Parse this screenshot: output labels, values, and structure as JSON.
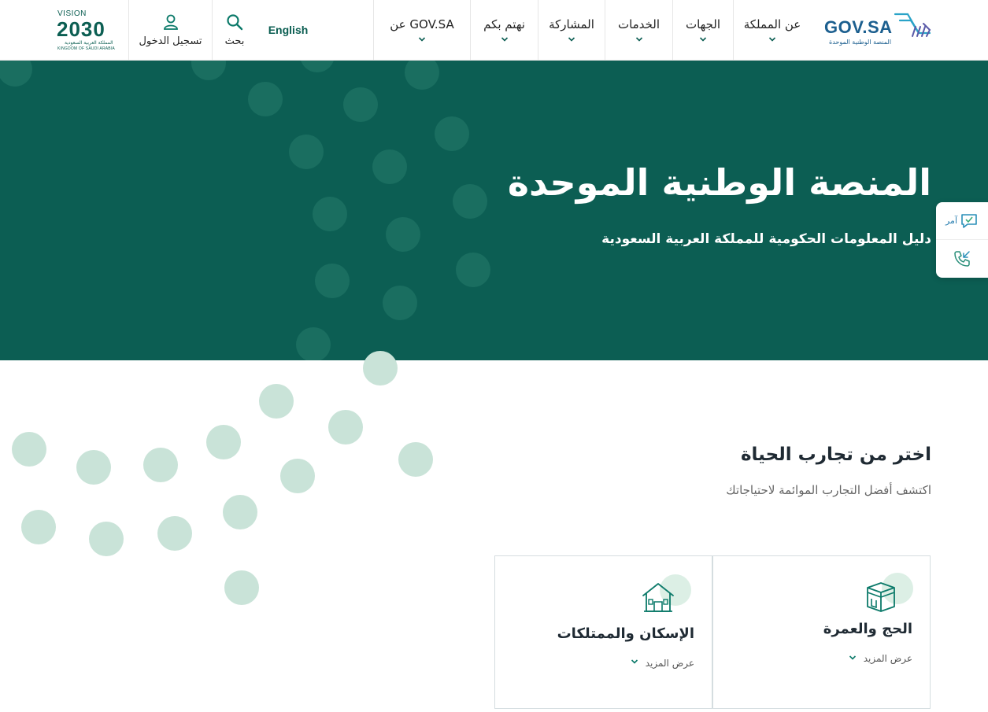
{
  "header": {
    "logo_word": "GOV.SA",
    "logo_sub": "المنصة الوطنية الموحدة",
    "nav": [
      {
        "label": "عن المملكة"
      },
      {
        "label": "الجهات"
      },
      {
        "label": "الخدمات"
      },
      {
        "label": "المشاركة"
      },
      {
        "label": "نهتم بكم"
      },
      {
        "label": "عن GOV.SA"
      }
    ],
    "language": "English",
    "search_label": "بحث",
    "login_label": "تسجيل الدخول",
    "vision": {
      "line1": "VISION",
      "year": "2030",
      "ar": "المملكة العربية السعودية",
      "en": "KINGDOM OF SAUDI ARABIA"
    }
  },
  "hero": {
    "title": "المنصة الوطنية الموحدة",
    "subtitle": "دليل المعلومات الحكومية للمملكة العربية السعودية"
  },
  "widget": {
    "chat_label": "آمر"
  },
  "life": {
    "title": "اختر من تجارب الحياة",
    "subtitle": "اكتشف أفضل التجارب الموائمة لاحتياجاتك",
    "cards": [
      {
        "title": "الحج والعمرة",
        "more": "عرض المزيد",
        "icon": "kaaba-icon"
      },
      {
        "title": "الإسكان والممتلكات",
        "more": "عرض المزيد",
        "icon": "house-icon"
      }
    ]
  },
  "colors": {
    "brand_green": "#0c5e53",
    "dot_dark": "#1a6e60",
    "dot_light": "#c9e3d8",
    "accent_blue": "#1c5f8f"
  }
}
